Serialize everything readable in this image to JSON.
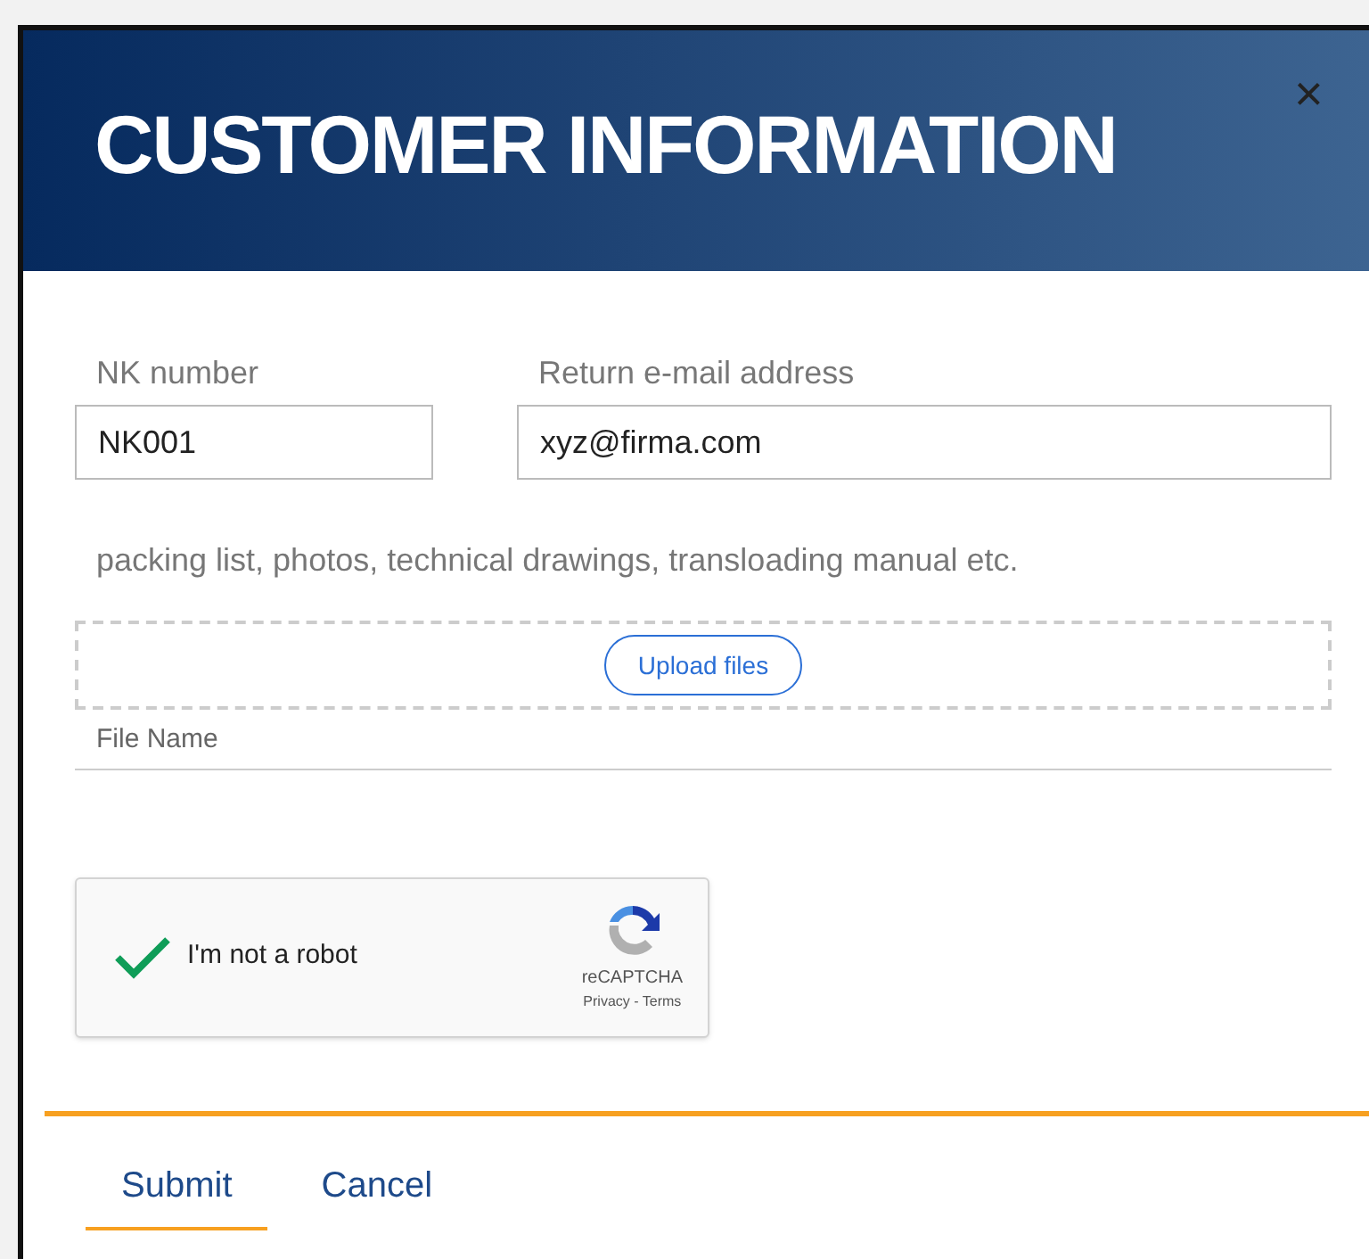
{
  "dialog": {
    "title": "CUSTOMER INFORMATION",
    "close": "×"
  },
  "fields": [
    {
      "label": "NK number",
      "value": "NK001"
    },
    {
      "label": "Return e-mail address",
      "value": "xyz@firma.com"
    }
  ],
  "upload": {
    "hint": "packing list, photos, technical drawings, transloading manual etc.",
    "button": "Upload files",
    "column": "File Name"
  },
  "captcha": {
    "label": "I'm not a robot",
    "checked": true,
    "brand": "reCAPTCHA",
    "links": "Privacy - Terms"
  },
  "buttons": [
    {
      "label": "Submit",
      "selected": true
    },
    {
      "label": "Cancel",
      "selected": false
    }
  ]
}
